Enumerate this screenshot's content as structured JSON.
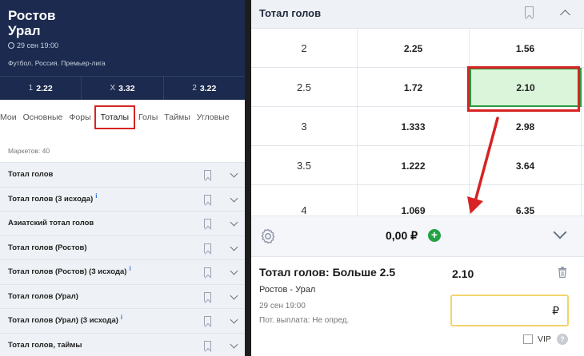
{
  "match": {
    "team1": "Ростов",
    "team2": "Урал",
    "datetime": "29 сен 19:00",
    "league": "Футбол. Россия. Премьер-лига",
    "odds": [
      {
        "label": "1",
        "value": "2.22"
      },
      {
        "label": "X",
        "value": "3.32"
      },
      {
        "label": "2",
        "value": "3.22"
      }
    ]
  },
  "tabs": [
    "Мои",
    "Основные",
    "Форы",
    "Тоталы",
    "Голы",
    "Таймы",
    "Угловые"
  ],
  "active_tab": "Тоталы",
  "markets_count_label": "Маркетов: 40",
  "markets": [
    {
      "label": "Тотал голов",
      "info": ""
    },
    {
      "label": "Тотал голов (3 исхода)",
      "info": "i"
    },
    {
      "label": "Азиатский тотал голов",
      "info": ""
    },
    {
      "label": "Тотал голов (Ростов)",
      "info": ""
    },
    {
      "label": "Тотал голов (Ростов) (3 исхода)",
      "info": "i"
    },
    {
      "label": "Тотал голов (Урал)",
      "info": ""
    },
    {
      "label": "Тотал голов (Урал) (3 исхода)",
      "info": "i"
    },
    {
      "label": "Тотал голов, таймы",
      "info": ""
    }
  ],
  "totals_panel": {
    "title": "Тотал голов",
    "rows": [
      {
        "line": "2",
        "under": "2.25",
        "over": "1.56"
      },
      {
        "line": "2.5",
        "under": "1.72",
        "over": "2.10"
      },
      {
        "line": "3",
        "under": "1.333",
        "over": "2.98"
      },
      {
        "line": "3.5",
        "under": "1.222",
        "over": "3.64"
      },
      {
        "line": "4",
        "under": "1.069",
        "over": "6.35"
      }
    ],
    "selected": {
      "row": 1,
      "col": "over"
    }
  },
  "bet_slip": {
    "balance": "0,00 ₽",
    "plus_label": "+",
    "title": "Тотал голов: Больше 2.5",
    "odd": "2.10",
    "match": "Ростов - Урал",
    "datetime": "29 сен 19:00",
    "payout": "Пот. выплата: Не опред.",
    "stake_placeholder": "₽",
    "vip_label": "VIP",
    "vip_help": "?"
  },
  "colors": {
    "header_bg": "#1b2a4e",
    "highlight_red": "#d72323",
    "selected_green": "#daf5d9",
    "plus_green": "#23a244",
    "stake_border": "#f3d46b"
  }
}
